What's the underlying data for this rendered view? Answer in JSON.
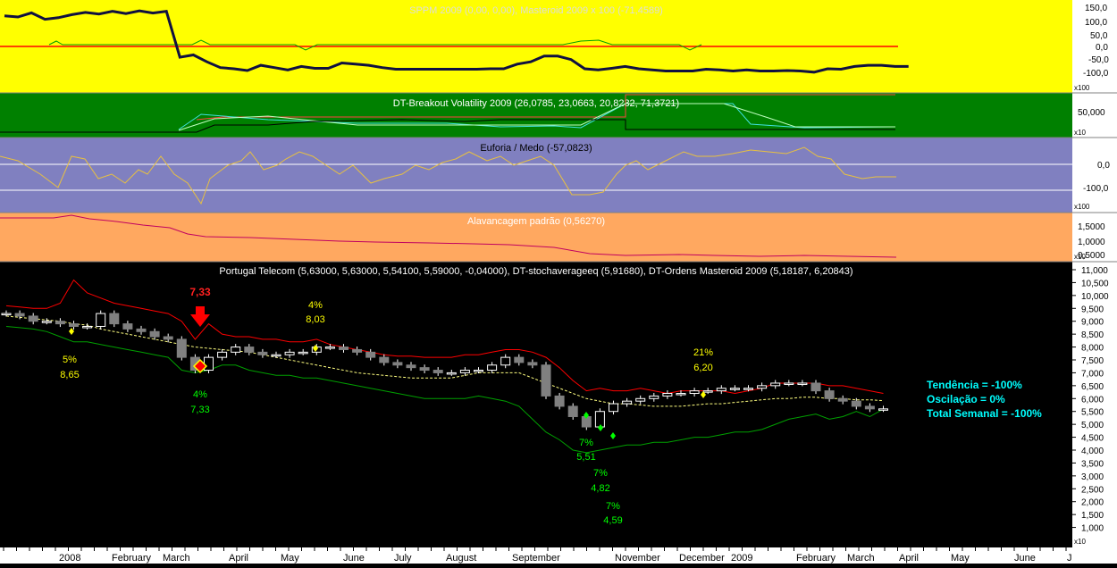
{
  "colors": {
    "panel_sppm": "#ffff00",
    "panel_breakout": "#008000",
    "panel_euforia": "#8080c0",
    "panel_alavancagem": "#ffa860",
    "panel_price": "#000000",
    "axis_bg": "#ffffff",
    "red_band": "#ff0000",
    "green_band": "#00a000",
    "midline": "#ffff80"
  },
  "x_axis": {
    "labels": [
      "2008",
      "February",
      "March",
      "April",
      "May",
      "June",
      "July",
      "August",
      "September",
      "November",
      "December",
      "2009",
      "February",
      "March",
      "April",
      "May",
      "June",
      "J"
    ]
  },
  "panels": {
    "sppm": {
      "title": "SPPM 2009 (0,00, 0,00), Masteroid 2009 x 100 (-71,4589)",
      "ticks": [
        "150,0",
        "100,0",
        "50,0",
        "0,0",
        "-50,0",
        "-100,0"
      ],
      "scale": "x100",
      "ylim": [
        -150,
        180
      ]
    },
    "breakout": {
      "title": "DT-Breakout Volatility 2009 (26,0785, 23,0663, 20,8232, 71,3721)",
      "ticks": [
        "50,000"
      ],
      "scale": "x10"
    },
    "euforia": {
      "title": "Euforia / Medo (-57,0823)",
      "ticks": [
        "0,0",
        "-100,0"
      ],
      "scale": "x100"
    },
    "alavancagem": {
      "title": "Alavancagem padrão (0,56270)",
      "ticks": [
        "1,5000",
        "1,0000",
        "0,5000"
      ],
      "scale": "x10"
    },
    "price": {
      "title": "Portugal Telecom (5,63000, 5,63000, 5,54100, 5,59000, -0,04000), DT-stochaverageeq (5,91680), DT-Ordens Masteroid 2009 (5,18187, 6,20843)",
      "ticks": [
        "11,000",
        "10,500",
        "10,000",
        "9,500",
        "9,000",
        "8,500",
        "8,000",
        "7,500",
        "7,000",
        "6,500",
        "6,000",
        "5,500",
        "5,000",
        "4,500",
        "4,000",
        "3,500",
        "3,000",
        "2,500",
        "2,000",
        "1,500",
        "1,000"
      ],
      "scale": "x10",
      "ylim": [
        0.5,
        11.0
      ]
    }
  },
  "signal": {
    "sell_price": "7,33"
  },
  "annotations": [
    {
      "pct": "5%",
      "price": "8,65",
      "color": "#ffff00"
    },
    {
      "pct": "4%",
      "price": "7,33",
      "color": "#00ff00"
    },
    {
      "pct": "4%",
      "price": "8,03",
      "color": "#ffff00"
    },
    {
      "pct": "7%",
      "price": "5,51",
      "color": "#00ff00"
    },
    {
      "pct": "7%",
      "price": "4,82",
      "color": "#00ff00"
    },
    {
      "pct": "7%",
      "price": "4,59",
      "color": "#00ff00"
    },
    {
      "pct": "21%",
      "price": "6,20",
      "color": "#ffff00"
    }
  ],
  "summary": {
    "tendencia": "Tendência = -100%",
    "oscilacao": "Oscilação = 0%",
    "total_semanal": "Total Semanal = -100%"
  },
  "chart_data": [
    {
      "type": "line",
      "name_ref": "SPPM 2009 / Masteroid 2009",
      "ylim": [
        -150,
        180
      ],
      "series": [
        {
          "name": "Masteroid 2009",
          "values": [
            150,
            145,
            163,
            135,
            142,
            155,
            165,
            158,
            170,
            160,
            172,
            162,
            170,
            -30,
            -20,
            -50,
            -75,
            -80,
            -88,
            -65,
            -75,
            -85,
            -70,
            -78,
            -78,
            -55,
            -60,
            -65,
            -75,
            -82,
            -82,
            -82,
            -82,
            -82,
            -82,
            -82,
            -80,
            -80,
            -60,
            -50,
            -25,
            -25,
            -40,
            -80,
            -85,
            -78,
            -70,
            -80,
            -85,
            -90,
            -90,
            -90,
            -82,
            -85,
            -90,
            -85,
            -90,
            -90,
            -88,
            -90,
            -95,
            -80,
            -82,
            -70,
            -65,
            -65,
            -70,
            -70
          ]
        },
        {
          "name": "SPPM 2009",
          "values": [
            0,
            0,
            0,
            0,
            0,
            0,
            0,
            0,
            0,
            0,
            0,
            0,
            0,
            0,
            15,
            0,
            0,
            0,
            0,
            0,
            0,
            0,
            0,
            0,
            0,
            0,
            0,
            0,
            0,
            0,
            0,
            0,
            0,
            0,
            0,
            0,
            0,
            0,
            0,
            0,
            0,
            0,
            0,
            0,
            0,
            0,
            0,
            0,
            0,
            0,
            0,
            0,
            0,
            0,
            0,
            0,
            0,
            0,
            0,
            0,
            0,
            0,
            0,
            0,
            0,
            0,
            0,
            0
          ]
        }
      ]
    },
    {
      "type": "candlestick",
      "ylim": [
        0.5,
        11.0
      ],
      "series": [
        {
          "name": "Portugal Telecom",
          "close": [
            9.3,
            9.2,
            9.0,
            9.0,
            8.9,
            8.8,
            8.8,
            9.3,
            8.9,
            8.7,
            8.6,
            8.4,
            8.3,
            7.6,
            7.1,
            7.6,
            7.8,
            8.0,
            7.8,
            7.7,
            7.7,
            7.8,
            7.8,
            8.0,
            8.0,
            7.9,
            7.8,
            7.6,
            7.4,
            7.3,
            7.2,
            7.1,
            7.0,
            7.0,
            7.1,
            7.1,
            7.3,
            7.6,
            7.4,
            7.3,
            6.1,
            5.7,
            5.3,
            4.9,
            5.5,
            5.8,
            5.9,
            6.0,
            6.1,
            6.2,
            6.2,
            6.3,
            6.3,
            6.4,
            6.4,
            6.4,
            6.5,
            6.6,
            6.6,
            6.6,
            6.3,
            6.0,
            5.9,
            5.7,
            5.6,
            5.6
          ]
        },
        {
          "name": "DT-stochaverageeq",
          "values": [
            9.2,
            9.15,
            9.1,
            9.05,
            9.0,
            8.9,
            8.85,
            8.7,
            8.6,
            8.5,
            8.4,
            8.3,
            8.2,
            8.1,
            8.0,
            7.95,
            7.9,
            7.85,
            7.8,
            7.7,
            7.6,
            7.5,
            7.4,
            7.3,
            7.2,
            7.1,
            7.0,
            6.95,
            6.9,
            6.85,
            6.8,
            6.8,
            6.8,
            6.8,
            6.9,
            7.0,
            7.0,
            7.0,
            7.0,
            6.8,
            6.6,
            6.4,
            6.2,
            6.0,
            5.9,
            5.8,
            5.8,
            5.75,
            5.7,
            5.7,
            5.7,
            5.75,
            5.8,
            5.8,
            5.85,
            5.9,
            5.95,
            6.0,
            6.0,
            6.05,
            6.05,
            6.0,
            6.0,
            5.95,
            5.95,
            5.92
          ]
        },
        {
          "name": "DT-Ordens Masteroid 2009 (upper)",
          "values": [
            9.6,
            9.55,
            9.5,
            9.5,
            9.7,
            10.6,
            10.1,
            9.9,
            9.7,
            9.6,
            9.5,
            9.4,
            9.3,
            9.0,
            8.3,
            8.9,
            8.5,
            8.4,
            8.4,
            8.3,
            8.3,
            8.2,
            8.2,
            8.3,
            8.1,
            8.0,
            7.9,
            7.8,
            7.7,
            7.65,
            7.65,
            7.6,
            7.6,
            7.6,
            7.7,
            7.7,
            7.8,
            7.9,
            7.9,
            7.8,
            7.6,
            7.2,
            6.7,
            6.3,
            6.4,
            6.3,
            6.3,
            6.4,
            6.3,
            6.2,
            6.3,
            6.3,
            6.3,
            6.3,
            6.2,
            6.3,
            6.4,
            6.6,
            6.6,
            6.6,
            6.6,
            6.5,
            6.5,
            6.4,
            6.3,
            6.2
          ]
        },
        {
          "name": "DT-Ordens Masteroid 2009 (lower)",
          "values": [
            8.8,
            8.75,
            8.7,
            8.6,
            8.4,
            8.2,
            8.2,
            8.1,
            8.0,
            7.9,
            7.8,
            7.7,
            7.6,
            7.1,
            7.0,
            7.1,
            7.3,
            7.3,
            7.1,
            7.0,
            6.9,
            6.9,
            6.8,
            6.8,
            6.7,
            6.6,
            6.5,
            6.4,
            6.3,
            6.2,
            6.1,
            6.0,
            6.0,
            6.0,
            6.0,
            6.1,
            6.0,
            5.9,
            5.7,
            5.2,
            4.7,
            4.4,
            4.0,
            3.9,
            4.0,
            4.1,
            4.2,
            4.2,
            4.3,
            4.3,
            4.4,
            4.5,
            4.5,
            4.6,
            4.7,
            4.7,
            4.8,
            5.0,
            5.2,
            5.3,
            5.4,
            5.2,
            5.3,
            5.5,
            5.3,
            5.59
          ]
        }
      ]
    }
  ]
}
